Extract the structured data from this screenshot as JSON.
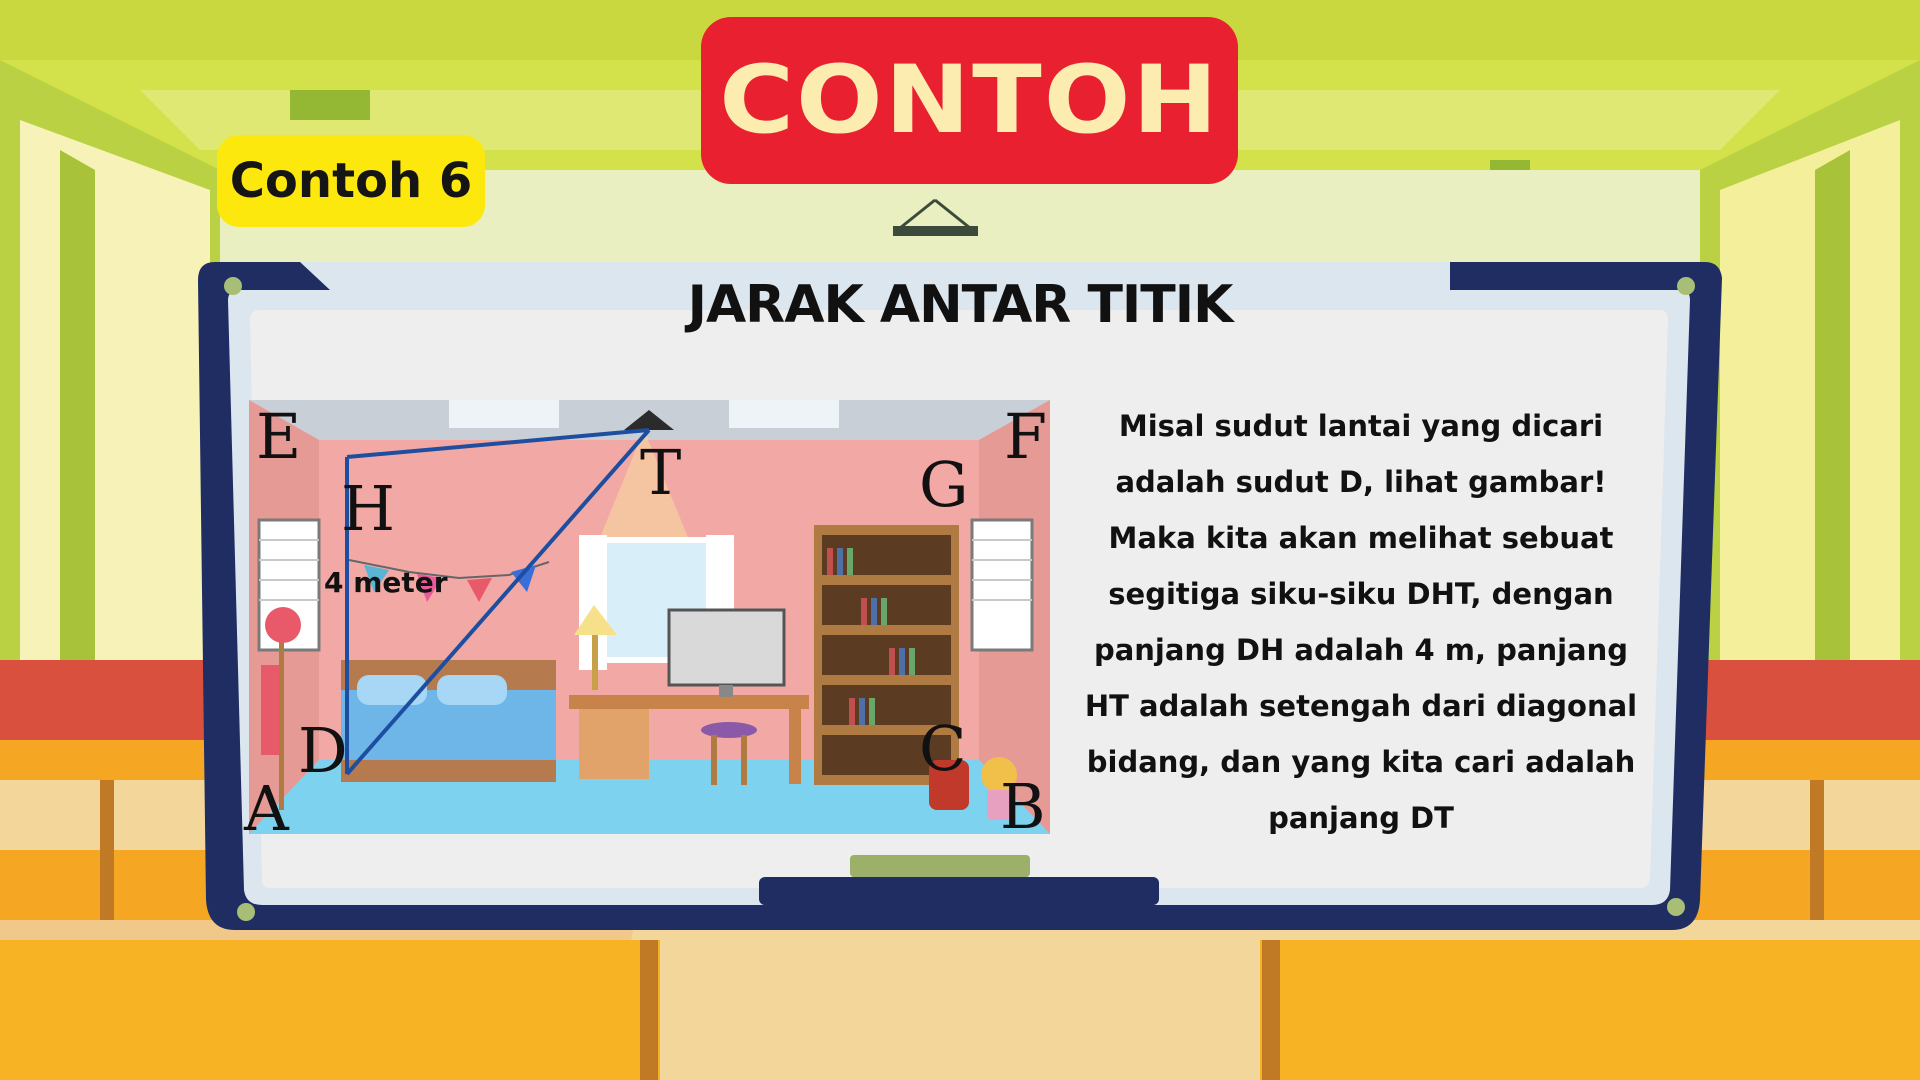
{
  "header": {
    "title": "CONTOH"
  },
  "example_tag": {
    "label": "Contoh 6"
  },
  "board": {
    "title": "JARAK ANTAR TITIK",
    "explanation": "Misal sudut lantai yang dicari adalah sudut D, lihat gambar! Maka kita akan melihat sebuat segitiga siku-siku DHT, dengan panjang DH adalah 4 m, panjang HT adalah setengah dari diagonal bidang, dan yang kita cari adalah panjang DT"
  },
  "figure": {
    "labels": {
      "E": "E",
      "F": "F",
      "H": "H",
      "T": "T",
      "G": "G",
      "D": "D",
      "C": "C",
      "A": "A",
      "B": "B"
    },
    "measure": "4 meter"
  },
  "colors": {
    "banner": "#e8202f",
    "banner_text": "#fcecb0",
    "tag": "#fde80d",
    "board_frame": "#1f2d63",
    "wall": "#f2a9a5",
    "floor": "#7dd3ef",
    "triangle_line": "#1e4ea0"
  }
}
